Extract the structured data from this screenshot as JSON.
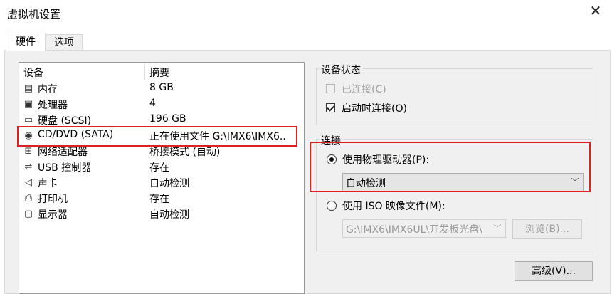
{
  "window": {
    "title": "虚拟机设置",
    "close_glyph": "✕"
  },
  "tabs": [
    {
      "label": "硬件",
      "active": true
    },
    {
      "label": "选项",
      "active": false
    }
  ],
  "device_table": {
    "columns": [
      "设备",
      "摘要"
    ],
    "rows": [
      {
        "icon": "memory-icon",
        "glyph": "▤",
        "name": "内存",
        "summary": "8 GB"
      },
      {
        "icon": "processor-icon",
        "glyph": "▣",
        "name": "处理器",
        "summary": "4"
      },
      {
        "icon": "hard-disk-icon",
        "glyph": "▭",
        "name": "硬盘 (SCSI)",
        "summary": "196 GB"
      },
      {
        "icon": "cd-dvd-icon",
        "glyph": "◉",
        "name": "CD/DVD (SATA)",
        "summary": "正在使用文件 G:\\IMX6\\IMX6.."
      },
      {
        "icon": "network-adapter-icon",
        "glyph": "⊞",
        "name": "网络适配器",
        "summary": "桥接模式 (自动)"
      },
      {
        "icon": "usb-controller-icon",
        "glyph": "⇌",
        "name": "USB 控制器",
        "summary": "存在"
      },
      {
        "icon": "sound-card-icon",
        "glyph": "◁",
        "name": "声卡",
        "summary": "自动检测"
      },
      {
        "icon": "printer-icon",
        "glyph": "⎙",
        "name": "打印机",
        "summary": "存在"
      },
      {
        "icon": "display-icon",
        "glyph": "▢",
        "name": "显示器",
        "summary": "自动检测"
      }
    ]
  },
  "device_status": {
    "title": "设备状态",
    "connected": {
      "label": "已连接(C)",
      "checked": false,
      "enabled": false
    },
    "connect_at_power_on": {
      "label": "启动时连接(O)",
      "checked": true,
      "enabled": true
    }
  },
  "connection": {
    "title": "连接",
    "use_physical_drive": {
      "label": "使用物理驱动器(P):",
      "selected": true
    },
    "physical_drive_select": {
      "value": "自动检测"
    },
    "use_iso_image": {
      "label": "使用 ISO 映像文件(M):",
      "selected": false
    },
    "iso_path_select": {
      "value": "G:\\IMX6\\IMX6UL\\开发板光盘\\"
    },
    "browse_button": "浏览(B)..."
  },
  "advanced_button": "高级(V)...",
  "colors": {
    "highlight_box": "#e02020",
    "panel_bg": "#f0f0f0"
  }
}
